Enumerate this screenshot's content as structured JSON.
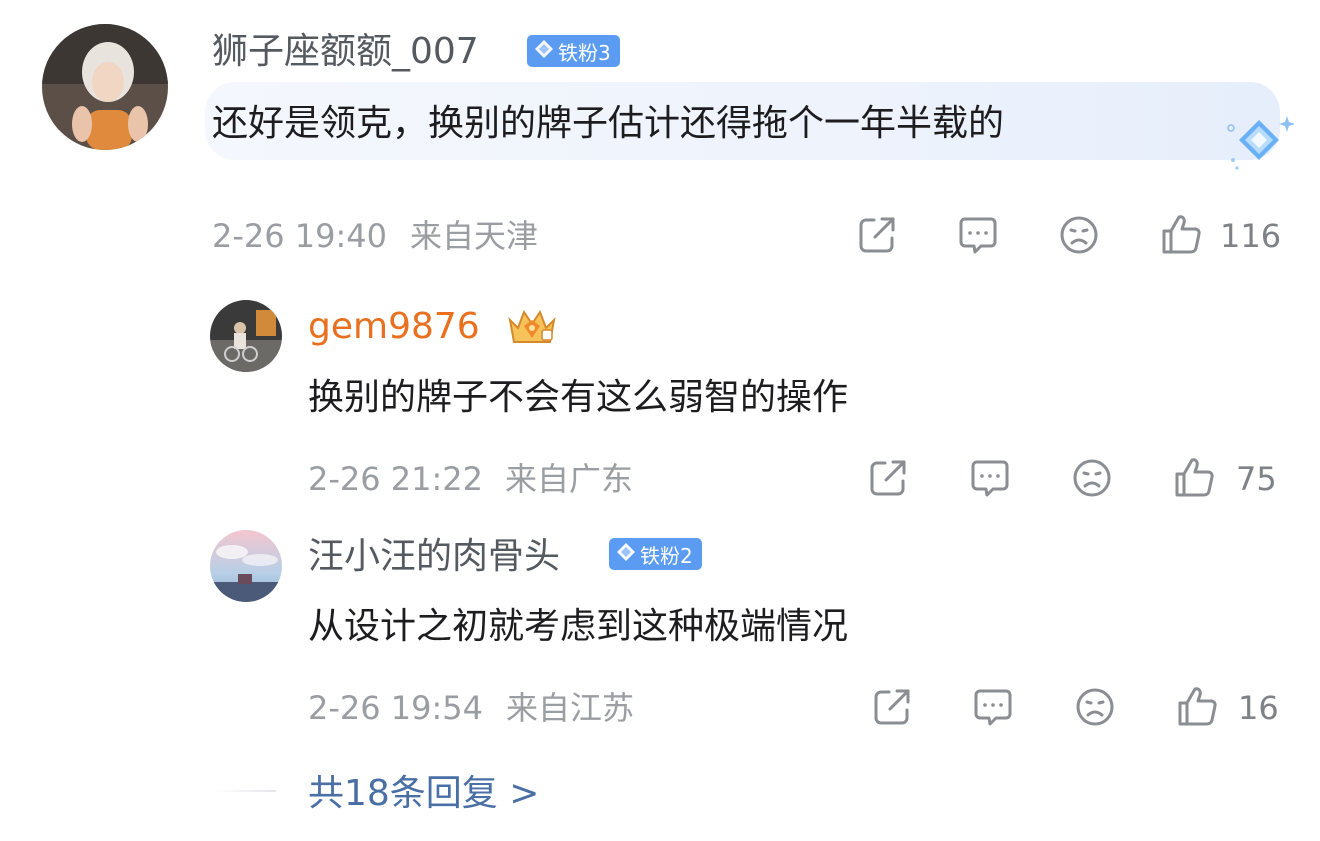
{
  "comment": {
    "username": "狮子座额额_007",
    "badge": "铁粉3",
    "text": "还好是领克，换别的牌子估计还得拖个一年半载的",
    "time": "2-26 19:40",
    "location": "来自天津",
    "likes": "116",
    "icons": [
      "share-icon",
      "comment-icon",
      "sad-face-icon",
      "thumbs-up-icon"
    ]
  },
  "replies": [
    {
      "username": "gem9876",
      "badge_icon": "crown-badge-icon",
      "text": "换别的牌子不会有这么弱智的操作",
      "time": "2-26 21:22",
      "location": "来自广东",
      "likes": "75"
    },
    {
      "username": "汪小汪的肉骨头",
      "badge": "铁粉2",
      "text": "从设计之初就考虑到这种极端情况",
      "time": "2-26 19:54",
      "location": "来自江苏",
      "likes": "16"
    }
  ],
  "more_replies": "共18条回复 >",
  "colors": {
    "badge": "#5b9cf2",
    "vip_name": "#e8701f",
    "link": "#4a6fa5",
    "meta": "#9a9da2"
  }
}
